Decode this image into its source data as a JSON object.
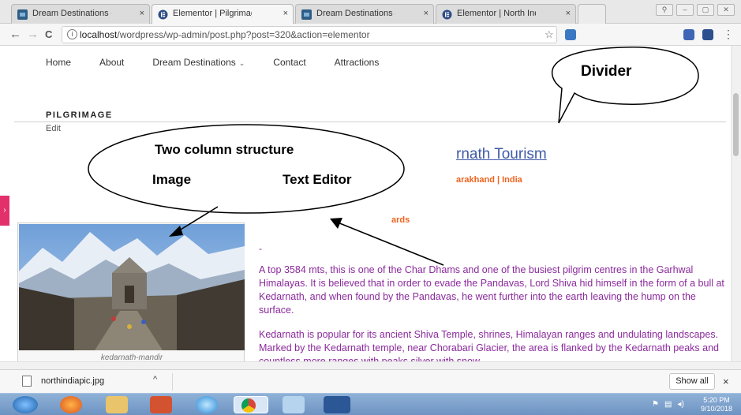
{
  "browser": {
    "tabs": [
      {
        "label": "Dream Destinations – BH",
        "active": false,
        "icon": "wordpress-icon"
      },
      {
        "label": "Elementor | Pilgrimage",
        "active": true,
        "icon": "elementor-icon"
      },
      {
        "label": "Dream Destinations – BH",
        "active": false,
        "icon": "wordpress-icon"
      },
      {
        "label": "Elementor | North India",
        "active": false,
        "icon": "elementor-icon"
      }
    ],
    "tab_close": "×",
    "url_host": "localhost",
    "url_path": "/wordpress/wp-admin/post.php?post=320&action=elementor",
    "star": "☆",
    "back": "←",
    "forward": "→",
    "reload": "C",
    "menu": "⋮"
  },
  "site_nav": {
    "items": [
      "Home",
      "About",
      "Dream Destinations",
      "Contact",
      "Attractions"
    ],
    "dropdown_indicator": "⌄"
  },
  "page": {
    "title": "PILGRIMAGE",
    "edit_link": "Edit",
    "heading_partial": "rnath Tourism",
    "subheading_partial": "arakhand | India",
    "orange_partial": "ards",
    "dash": "-",
    "paragraph1": "A top 3584 mts, this is one of the Char Dhams and one of the busiest pilgrim centres in the Garhwal Himalayas. It is believed that in order to evade the Pandavas, Lord Shiva hid himself in the form of a bull at Kedarnath, and when found by the Pandavas, he went further into the earth leaving the hump on the surface.",
    "paragraph2": "Kedarnath is popular for its ancient Shiva Temple, shrines, Himalayan ranges and undulating landscapes. Marked by the Kedarnath temple, near Chorabari Glacier, the area is flanked by the Kedarnath peaks and countless more ranges with peaks silver with snow",
    "image_caption": "kedarnath-mandir",
    "side_handle": "›"
  },
  "annotations": {
    "divider_label": "Divider",
    "structure_title": "Two column structure",
    "col_image": "Image",
    "col_text": "Text Editor"
  },
  "download_bar": {
    "filename": "northindiapic.jpg",
    "caret": "^",
    "show_all": "Show all",
    "close": "×"
  },
  "taskbar": {
    "time": "5:20 PM",
    "date": "9/10/2018"
  },
  "colors": {
    "heading_blue": "#3f5aa8",
    "accent_orange": "#f0631e",
    "text_purple": "#8b2a9c",
    "elementor_pink": "#e2306b"
  }
}
